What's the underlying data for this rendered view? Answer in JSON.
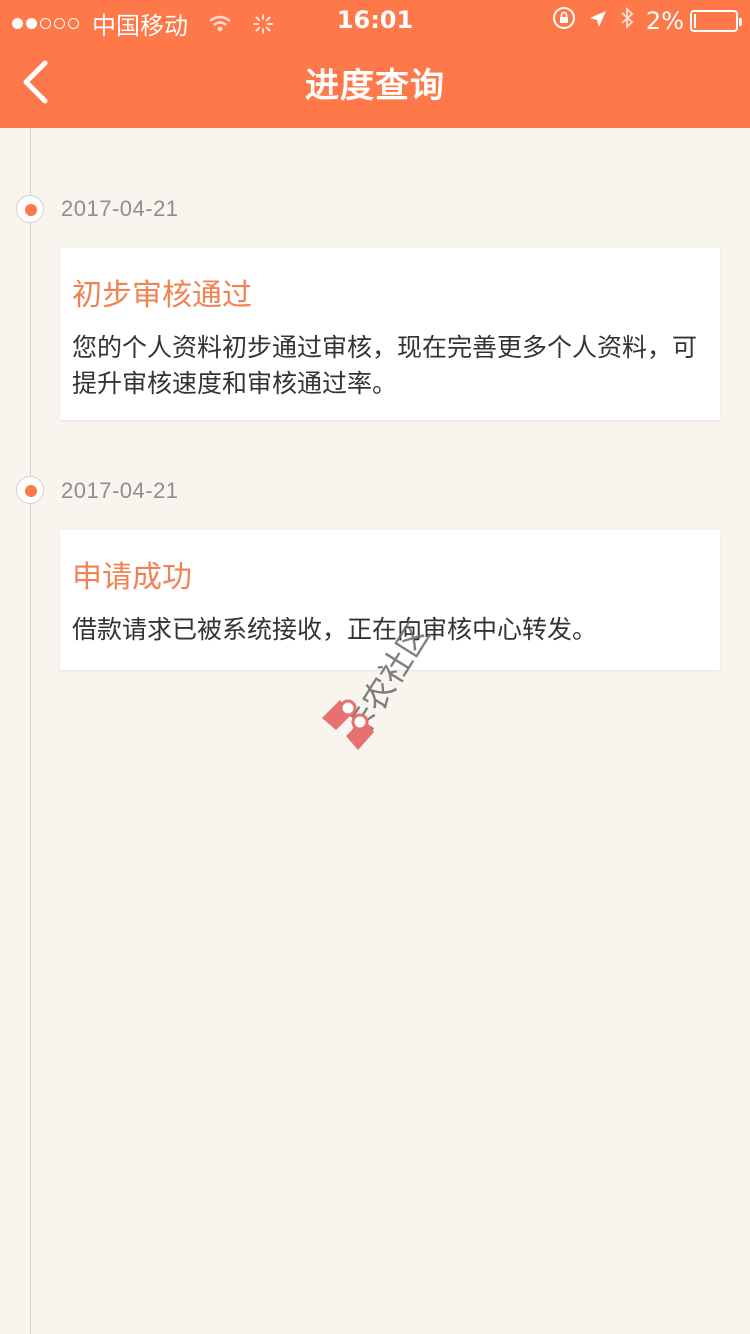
{
  "status_bar": {
    "carrier": "中国移动",
    "time": "16:01",
    "battery": "2%",
    "battery_level": 0.02
  },
  "header": {
    "title": "进度查询",
    "color": "#ff7849"
  },
  "timeline": [
    {
      "date": "2017-04-21",
      "title": "初步审核通过",
      "body": "您的个人资料初步通过审核，现在完善更多个人资料，可提升审核速度和审核通过率。"
    },
    {
      "date": "2017-04-21",
      "title": "申请成功",
      "body": "借款请求已被系统接收，正在向审核中心转发。"
    }
  ],
  "watermark": {
    "text": "卡农社区"
  },
  "colors": {
    "accent": "#ff7849",
    "card_title": "#f08354",
    "background": "#f8f4ee"
  }
}
